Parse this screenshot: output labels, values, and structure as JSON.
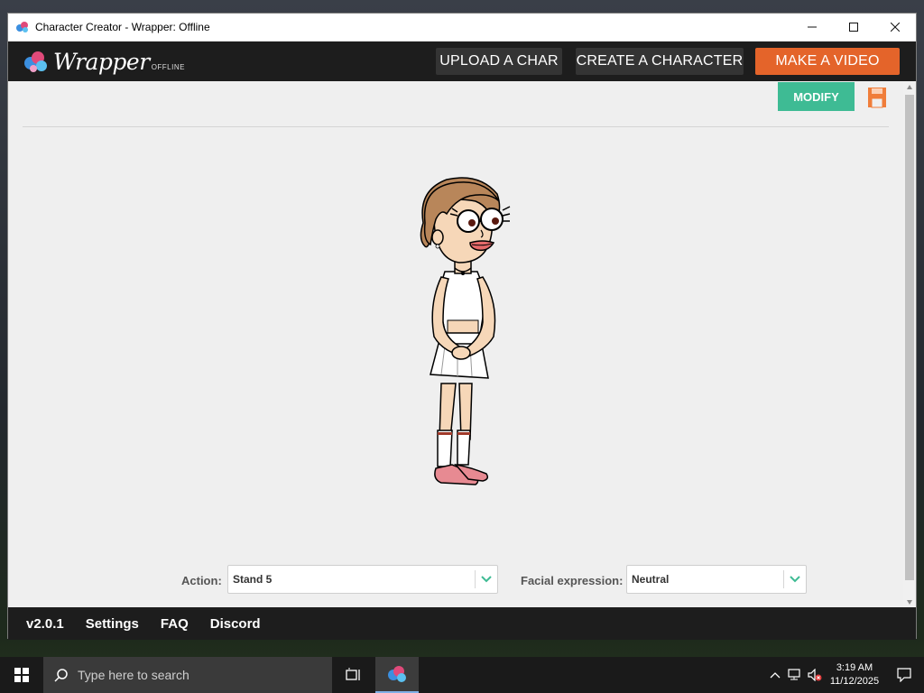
{
  "window": {
    "title": "Character Creator - Wrapper: Offline"
  },
  "appbar": {
    "logo_text": "Wrapper",
    "logo_sub": "OFFLINE",
    "upload_label": "UPLOAD A CHAR",
    "create_label": "CREATE A CHARACTER",
    "video_label": "MAKE A VIDEO"
  },
  "content": {
    "modify_label": "MODIFY",
    "action_label": "Action:",
    "action_value": "Stand 5",
    "expression_label": "Facial expression:",
    "expression_value": "Neutral"
  },
  "footer": {
    "version": "v2.0.1",
    "settings": "Settings",
    "faq": "FAQ",
    "discord": "Discord"
  },
  "taskbar": {
    "search_placeholder": "Type here to search",
    "time": "3:19 AM",
    "date": "11/12/2025"
  },
  "colors": {
    "accent_orange": "#e4642a",
    "modify_green": "#3ebb94",
    "bar_dark": "#1d1d1d"
  },
  "icons": [
    "app-icon",
    "minimize-icon",
    "maximize-icon",
    "close-icon",
    "save-icon",
    "chevron-down-icon",
    "windows-start-icon",
    "search-icon",
    "task-view-icon",
    "wrapper-app-icon",
    "chevron-up-icon",
    "network-icon",
    "volume-muted-icon",
    "notification-icon"
  ]
}
